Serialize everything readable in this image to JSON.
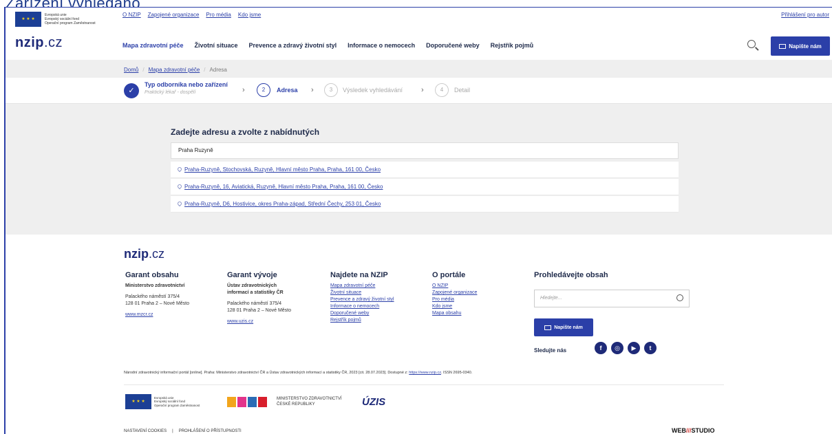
{
  "caption": "Zařízení vyhledáno",
  "eu_logo": {
    "lines": [
      "Evropská unie",
      "Evropský sociální fond",
      "Operační program Zaměstnanost"
    ]
  },
  "toplinks": [
    "O NZIP",
    "Zapojené organizace",
    "Pro média",
    "Kdo jsme"
  ],
  "login_label": "Přihlášení pro autor",
  "logo": {
    "main": "nzip",
    "tld": ".cz"
  },
  "nav": [
    "Mapa zdravotní péče",
    "Životní situace",
    "Prevence a zdravý životní styl",
    "Informace o nemocech",
    "Doporučené weby",
    "Rejstřík pojmů"
  ],
  "write_button": "Napište nám",
  "breadcrumb": [
    "Domů",
    "Mapa zdravotní péče",
    "Adresa"
  ],
  "stepper": {
    "step1_label": "Typ odborníka nebo zařízení",
    "step1_sub": "Praktický lékař - dospělí",
    "steps": [
      {
        "num": "2",
        "label": "Adresa"
      },
      {
        "num": "3",
        "label": "Výsledek vyhledávání"
      },
      {
        "num": "4",
        "label": "Detail"
      }
    ]
  },
  "address": {
    "title": "Zadejte adresu a zvolte z nabídnutých",
    "input_value": "Praha Ruzyně",
    "suggestions": [
      "Praha-Ruzyně, Stochovská, Ruzyně, Hlavní město Praha, Praha, 161 00, Česko",
      "Praha-Ruzyně, 16, Aviatická, Ruzyně, Hlavní město Praha, Praha, 161 00, Česko",
      "Praha-Ruzyně, D6, Hostivice, okres Praha-západ, Střední Čechy, 253 01, Česko"
    ]
  },
  "footer": {
    "col1": {
      "title": "Garant obsahu",
      "org": "Ministerstvo zdravotnictví",
      "addr1": "Palackého náměstí 375/4",
      "addr2": "128 01 Praha 2 – Nové Město",
      "link": "www.mzcr.cz"
    },
    "col2": {
      "title": "Garant vývoje",
      "org1": "Ústav zdravotnických",
      "org2": "informací a statistiky ČR",
      "addr1": "Palackého náměstí 375/4",
      "addr2": "128 01 Praha 2 – Nové Město",
      "link": "www.uzis.cz"
    },
    "col3": {
      "title": "Najdete na NZIP",
      "links": [
        "Mapa zdravotní péče",
        "Životní situace",
        "Prevence a zdravý životní styl",
        "Informace o nemocech",
        "Doporučené weby",
        "Rejstřík pojmů"
      ]
    },
    "col4": {
      "title": "O portále",
      "links": [
        "O NZIP",
        "Zapojené organizace",
        "Pro média",
        "Kdo jsme",
        "Mapa obsahu"
      ]
    },
    "col5": {
      "title": "Prohledávejte obsah",
      "placeholder": "Hledejte...",
      "write_button": "Napište nám",
      "follow": "Sledujte nás"
    },
    "citation_text": "Národní zdravotnický informační portál [online]. Praha: Ministerstvo zdravotnictví ČR a Ústav zdravotnických informací a statistiky ČR, 2023 [cit. 28.07.2023]. Dostupné z: ",
    "citation_link": "https://www.nzip.cz",
    "citation_end": ". ISSN 2695-0340.",
    "ministry": [
      "MINISTERSTVO ZDRAVOTNICTVÍ",
      "ČESKÉ REPUBLIKY"
    ],
    "uzis": "ÚZIS",
    "bottom_links": [
      "NASTAVENÍ COOKIES",
      "|",
      "PROHLÁŠENÍ O PŘÍSTUPNOSTI"
    ],
    "webstudio_a": "WEB",
    "webstudio_b": "///",
    "webstudio_c": "STUDIO"
  },
  "colors": {
    "brand": "#2b3fa8",
    "logo": "#1e2a78"
  }
}
